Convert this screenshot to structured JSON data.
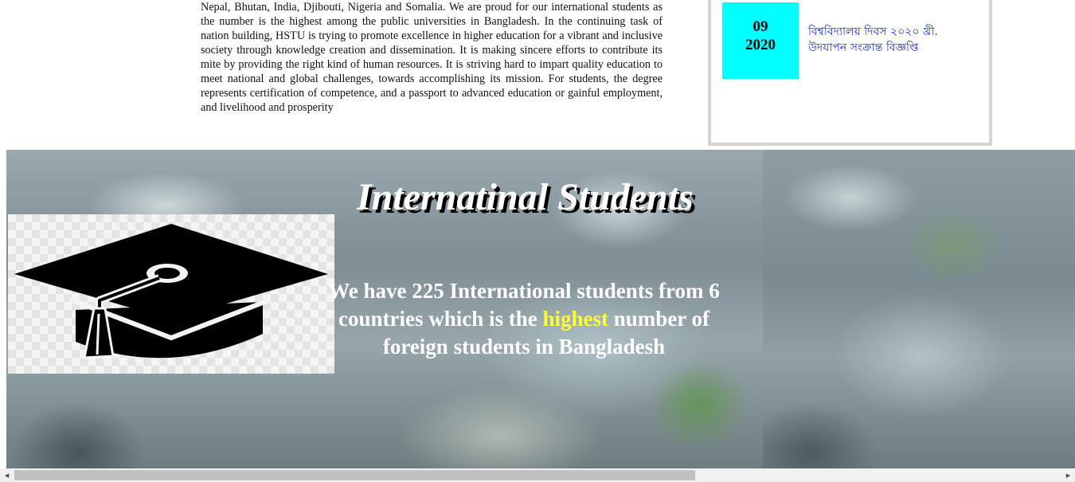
{
  "intro": {
    "paragraph": "Nepal, Bhutan, India, Djibouti, Nigeria and Somalia. We are proud for our international students as the number is the highest among the public universities in Bangladesh. In the continuing task of nation building, HSTU is trying to promote excellence in higher education for a vibrant and inclusive society through knowledge creation and dissemination. It is making sincere efforts to contribute its mite by providing the right kind of human resources. It is striving hard to impart quality education to meet national and global challenges, towards accomplishing its mission. For students, the degree represents certification of competence, and a passport to advanced education or gainful employment, and livelihood and prosperity"
  },
  "notice": {
    "day": "09",
    "year": "2020",
    "link_text": "বিশ্ববিদ্যালয় দিবস ২০২০ খ্রী. উদযাপন সংক্রান্ত বিজ্ঞপ্তি",
    "tile_color": "#00ffff",
    "link_color": "#1a2fd6"
  },
  "banner": {
    "title": "Internatinal Students",
    "text_before": "We have 225 International students from 6 countries which is the",
    "highlight": "highest",
    "text_after": "number of foreign students in Bangladesh",
    "highlight_color": "#ffff33",
    "icon": "graduation-cap-icon"
  },
  "scrollbar": {
    "left_arrow": "◂",
    "right_arrow": "▸"
  }
}
